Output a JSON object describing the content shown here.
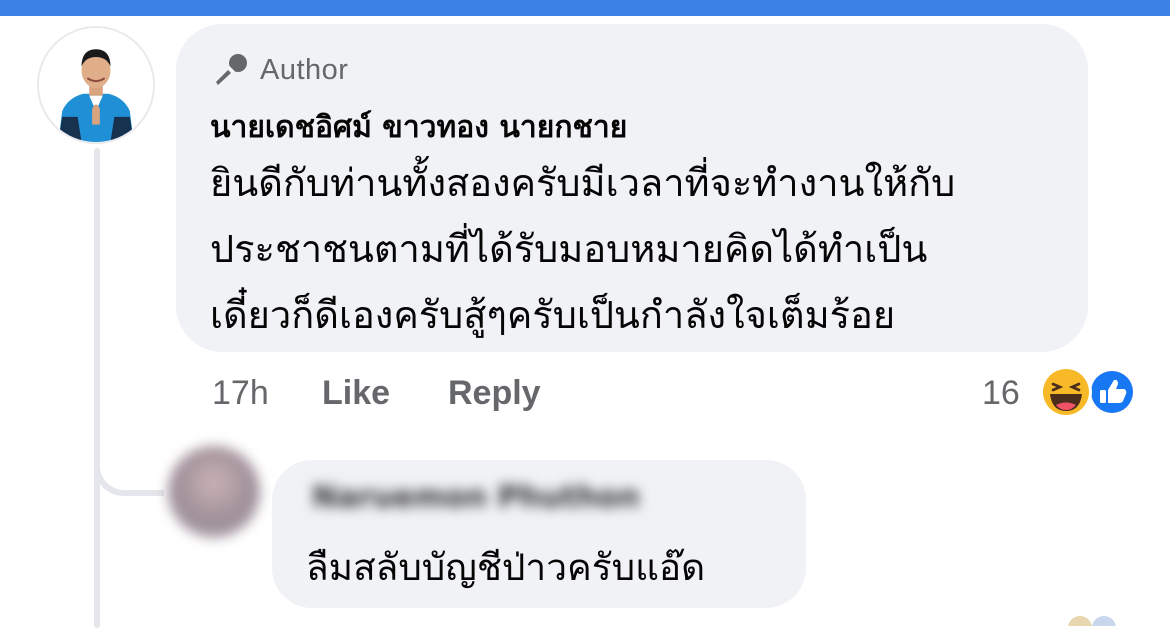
{
  "colors": {
    "accent": "#3b82e6",
    "bubble": "#f0f2f5",
    "muted": "#65676b",
    "text": "#050505",
    "like_blue": "#1877f2",
    "haha_yellow": "#f7b928"
  },
  "comment": {
    "badge": {
      "icon": "microphone-icon",
      "label": "Author"
    },
    "author_name": "นายเดชอิศม์ ขาวทอง นายกชาย",
    "text_lines": [
      "ยินดีกับท่านทั้งสองครับมีเวลาที่จะทำงานให้กับ",
      "ประชาชนตามที่ได้รับมอบหมายคิดได้ทำเป็น",
      "เดี๋ยวก็ดีเองครับสู้ๆครับเป็นกำลังใจเต็มร้อย"
    ],
    "time": "17h",
    "like_label": "Like",
    "reply_label": "Reply",
    "reaction_count": "16",
    "reactions": [
      "haha-icon",
      "like-icon"
    ]
  },
  "reply": {
    "author_name": "Naruemon Phuthon",
    "text": "ลืมสลับบัญชีป่าวครับแอ๊ด"
  }
}
